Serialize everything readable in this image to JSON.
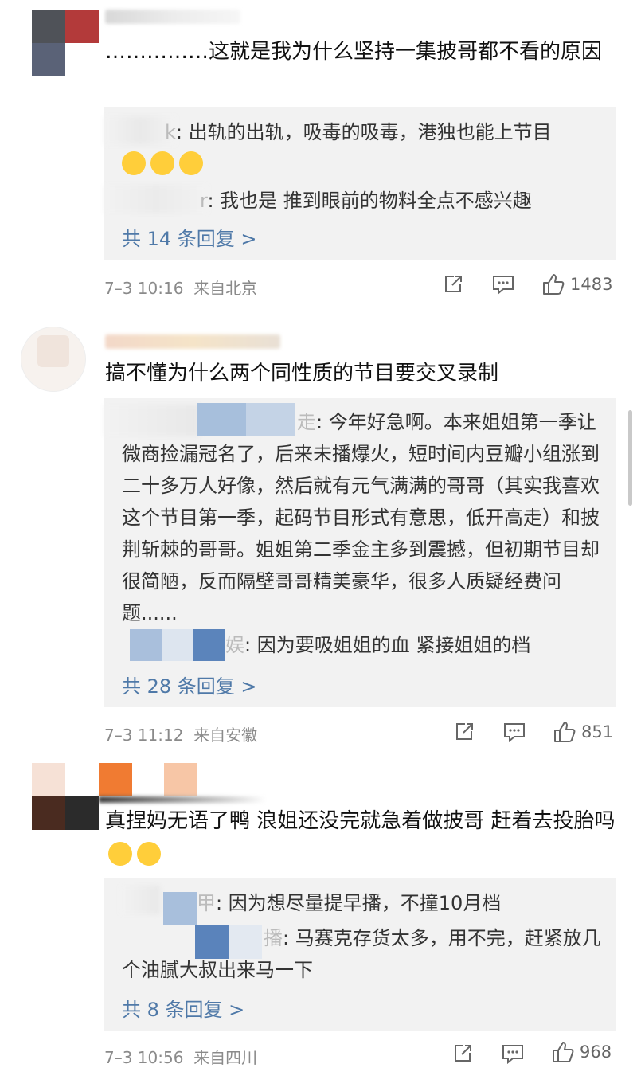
{
  "comments": [
    {
      "text": "……………这就是我为什么坚持一集披哥都不看的原因",
      "replies": [
        {
          "name_tail": "k",
          "text": ": 出轨的出轨，吸毒的吸毒，港独也能上节目"
        },
        {
          "name_tail": "r",
          "text": ": 我也是 推到眼前的物料全点不感兴趣"
        }
      ],
      "more": "共 14 条回复 >",
      "time": "7–3 10:16",
      "location": "来自北京",
      "likes": "1483"
    },
    {
      "text": "搞不懂为什么两个同性质的节目要交叉录制",
      "replies": [
        {
          "name_tail": "走",
          "text": ": 今年好急啊。本来姐姐第一季让微商捡漏冠名了，后来未播爆火，短时间内豆瓣小组涨到二十多万人好像，然后就有元气满满的哥哥（其实我喜欢这个节目第一季，起码节目形式有意思，低开高走）和披荆斩棘的哥哥。姐姐第二季金主多到震撼，但初期节目却很简陋，反而隔壁哥哥精美豪华，很多人质疑经费问题......"
        },
        {
          "name_tail": "娱",
          "text": ": 因为要吸姐姐的血 紧接姐姐的档"
        }
      ],
      "more": "共 28 条回复 >",
      "time": "7–3 11:12",
      "location": "来自安徽",
      "likes": "851"
    },
    {
      "text": "真捏妈无语了鸭 浪姐还没完就急着做披哥 赶着去投胎吗",
      "replies": [
        {
          "name_tail": "甲",
          "text": ": 因为想尽量提早播，不撞10月档"
        },
        {
          "name_tail": "播",
          "text": ": 马赛克存货太多，用不完，赶紧放几个油腻大叔出来马一下"
        }
      ],
      "more": "共 8 条回复 >",
      "time": "7–3 10:56",
      "location": "来自四川",
      "likes": "968"
    }
  ],
  "icons": {
    "share": "share-icon",
    "comment": "comment-icon",
    "like": "like-icon",
    "emoji": "crying-laughing-emoji",
    "smile": "smiling-emoji"
  },
  "colors": {
    "link": "#4f79a8",
    "meta": "#8a8a8a",
    "reply_bg": "#f2f2f2"
  }
}
